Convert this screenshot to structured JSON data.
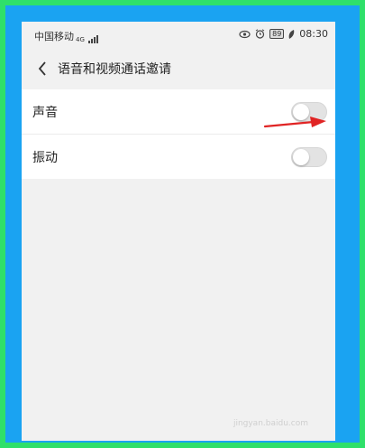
{
  "status_bar": {
    "carrier": "中国移动",
    "network": "4G",
    "battery": "89",
    "time": "08:30"
  },
  "header": {
    "title": "语音和视频通话邀请"
  },
  "settings": {
    "sound_label": "声音",
    "sound_enabled": false,
    "vibration_label": "振动",
    "vibration_enabled": false
  },
  "annotation": {
    "arrow_color": "#e02424"
  },
  "watermark": {
    "text": "jingyan.baidu.com"
  },
  "colors": {
    "frame_outer": "#2fe06a",
    "frame_inner": "#1aa3f2",
    "screen_bg": "#f1f1f1",
    "list_bg": "#ffffff",
    "toggle_off": "#e3e3e3"
  }
}
